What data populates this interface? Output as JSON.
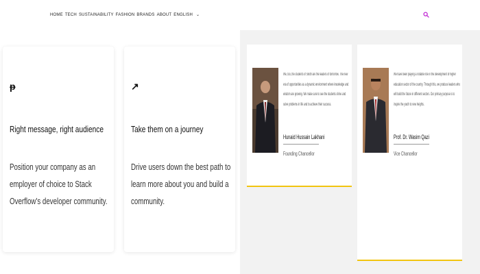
{
  "nav": {
    "items": [
      "HOME",
      "TECH",
      "SUSTAINABILITY",
      "FASHION",
      "BRANDS",
      "ABOUT",
      "ENGLISH"
    ],
    "language_chevron_icon": "chevron-down-icon",
    "search_icon": "search-icon",
    "search_icon_color": "#c026d3"
  },
  "cards": [
    {
      "icon": "megaphone-icon",
      "icon_glyph": "ᵽ",
      "title": "Right message, right audience",
      "body": "Position your company as an employer of choice to Stack Overflow's developer community."
    },
    {
      "icon": "path-icon",
      "icon_glyph": "↗",
      "title": "Take them on a journey",
      "body": "Drive users down the best path to learn more about you and build a community."
    }
  ],
  "people": [
    {
      "quote": "We, too, the students of Sindh are the leaders of tomorrow. The new era of opportunities as a dynamic environment where knowledge and wisdom are growing. We make sure to see the students shine and solve problems in life and to achieve their success.",
      "name": "Hunaid Hussain Lakhani",
      "role": "Founding Chancellor"
    },
    {
      "quote": "We have been playing a notable role in the development of higher education sector of the country. Through this, we produce leaders who will build the future in different sectors. Our primary purpose is to inspire the youth to new heights.",
      "name": "Prof. Dr. Wasim Qazi",
      "role": "Vice Chancellor"
    }
  ],
  "accent_color": "#f2c40f"
}
